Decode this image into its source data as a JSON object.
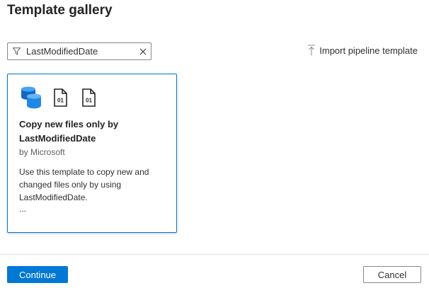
{
  "header": {
    "title": "Template gallery"
  },
  "search": {
    "value": "LastModifiedDate",
    "icon": "filter-icon",
    "clear_icon": "close-icon"
  },
  "toolbar": {
    "import_label": "Import pipeline template",
    "import_icon": "upload-icon"
  },
  "templates": [
    {
      "title": "Copy new files only by LastModifiedDate",
      "author": "by Microsoft",
      "description": "Use this template to copy new and changed files only by using LastModifiedDate.",
      "more": "...",
      "icons": [
        "database-icon",
        "binary-file-icon",
        "binary-file-icon"
      ],
      "file_icon_text": "01"
    }
  ],
  "footer": {
    "continue_label": "Continue",
    "cancel_label": "Cancel"
  },
  "colors": {
    "accent": "#0078d4",
    "database_blue": "#1e88e5"
  }
}
